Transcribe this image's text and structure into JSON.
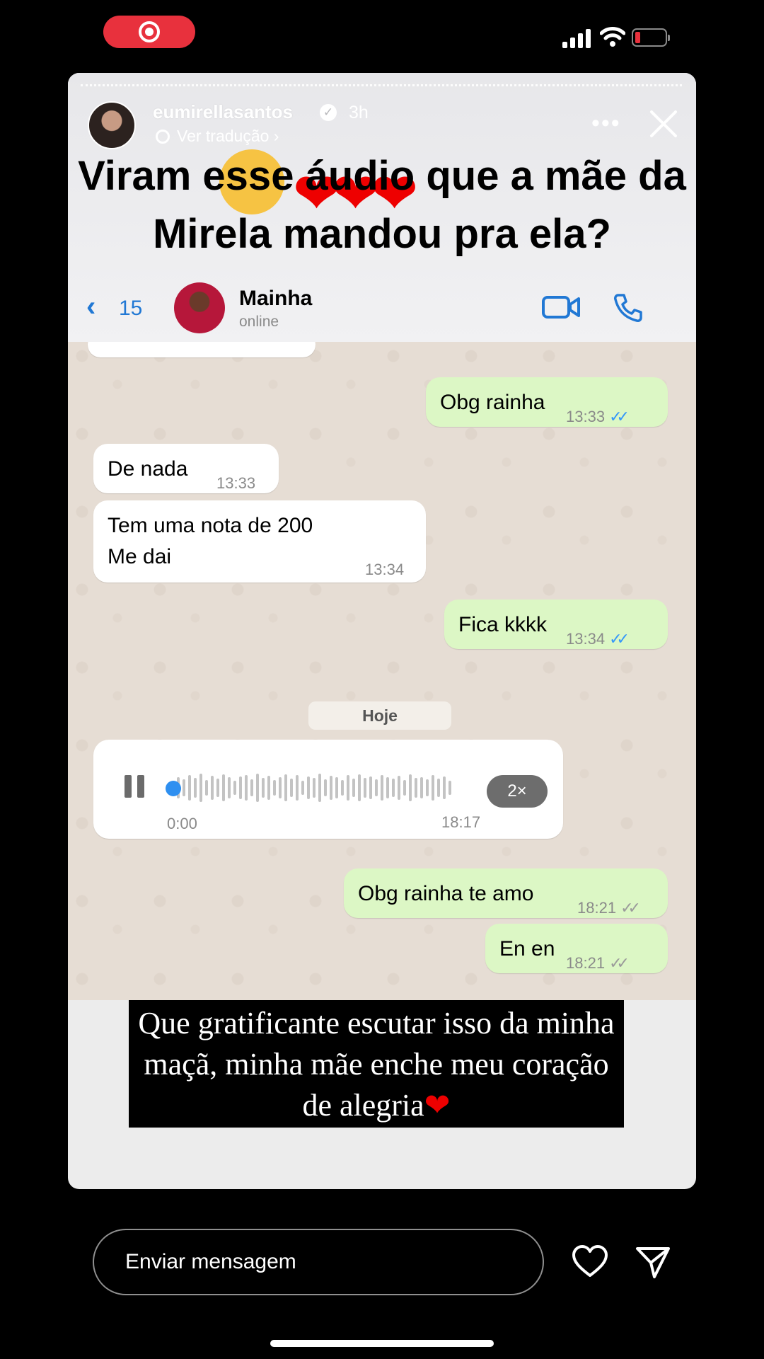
{
  "status_bar": {
    "recording": true,
    "battery_level": 0.1
  },
  "story": {
    "username": "eumirellasantos",
    "time_ago": "3h",
    "translate_label": "Ver tradução",
    "more_label": "•••",
    "overlay_text": "Viram esse áudio que a mãe da Mirela mandou pra ela?",
    "caption": "Que gratificante escutar isso da minha maçã, minha mãe enche meu coração de alegria"
  },
  "chat_header": {
    "back_count": "15",
    "contact_name": "Mainha",
    "contact_status": "online"
  },
  "messages": [
    {
      "from": "me",
      "text": "Obg rainha",
      "time": "13:33",
      "status": "read"
    },
    {
      "from": "them",
      "text": "De nada",
      "time": "13:33"
    },
    {
      "from": "them",
      "text": "Tem uma nota de 200",
      "text2": "Me dai",
      "time": "13:34"
    },
    {
      "from": "me",
      "text": "Fica kkkk",
      "time": "13:34",
      "status": "read"
    },
    {
      "from": "me",
      "text": "Obg rainha te amo",
      "time": "18:21",
      "status": "sent"
    },
    {
      "from": "me",
      "text": "En en",
      "time": "18:21",
      "status": "sent"
    }
  ],
  "day_separator": "Hoje",
  "audio_message": {
    "position": "0:00",
    "time": "18:17",
    "speed": "2×",
    "playing": true
  },
  "reply_bar": {
    "placeholder": "Enviar mensagem"
  },
  "colors": {
    "wa_blue": "#2178d4",
    "bubble_out": "#dcf7c5",
    "bubble_in": "#ffffff",
    "record_red": "#e8313d"
  }
}
